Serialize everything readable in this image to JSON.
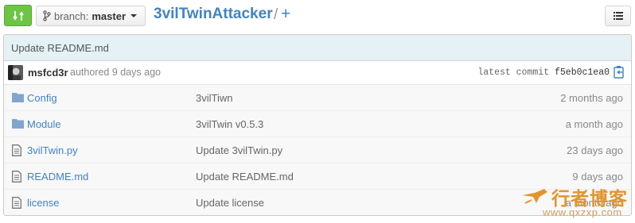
{
  "header": {
    "branch_prefix": "branch:",
    "branch_name": "master",
    "repo_name": "3vilTwinAttacker",
    "separator": "/",
    "add_label": "+"
  },
  "commit": {
    "title": "Update README.md",
    "author": "msfcd3r",
    "authored": "authored 9 days ago",
    "latest_label": "latest commit",
    "sha": "f5eb0c1ea0"
  },
  "files": [
    {
      "type": "folder",
      "name": "Config",
      "message": "3vilTiwn",
      "age": "2 months ago"
    },
    {
      "type": "folder",
      "name": "Module",
      "message": "3vilTwin v0.5.3",
      "age": "a month ago"
    },
    {
      "type": "file",
      "name": "3vilTwin.py",
      "message": "Update 3vilTwin.py",
      "age": "23 days ago"
    },
    {
      "type": "file",
      "name": "README.md",
      "message": "Update README.md",
      "age": "9 days ago"
    },
    {
      "type": "file",
      "name": "license",
      "message": "Update license",
      "age": "a month ago"
    }
  ],
  "watermark": {
    "title": "行者博客",
    "url": "www.qxzxp.com"
  },
  "colors": {
    "accent": "#4183c4",
    "compare_green": "#6cc644",
    "commit_bg": "#e6f1f6",
    "watermark": "#e2952e"
  },
  "icons": {
    "compare": "compare-icon",
    "branch": "branch-icon",
    "menu": "list-icon",
    "clipboard": "clipboard-icon",
    "folder": "folder-icon",
    "file": "file-icon"
  }
}
